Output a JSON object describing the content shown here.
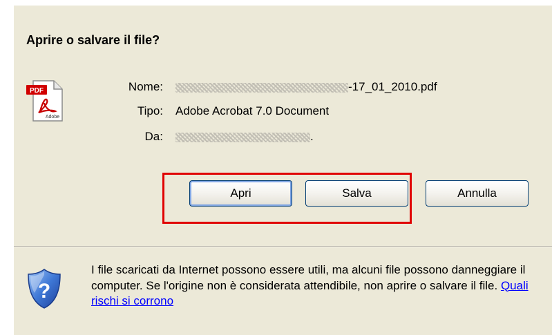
{
  "dialog": {
    "title": "Aprire o salvare il file?",
    "icon": "pdf-file-icon",
    "fields": {
      "name_label": "Nome:",
      "name_value_visible": "-17_01_2010.pdf",
      "type_label": "Tipo:",
      "type_value": "Adobe Acrobat 7.0 Document",
      "from_label": "Da:",
      "from_value_visible": "."
    },
    "buttons": {
      "open": "Apri",
      "save": "Salva",
      "cancel": "Annulla"
    },
    "warning": {
      "icon": "security-shield-question-icon",
      "text": "I file scaricati da Internet possono essere utili, ma alcuni file possono danneggiare il computer. Se l'origine non è considerata attendibile, non aprire o salvare il file.",
      "link": "Quali rischi si corrono"
    },
    "colors": {
      "background": "#ece9d8",
      "highlight": "#e00000",
      "link": "#0000ff"
    }
  }
}
